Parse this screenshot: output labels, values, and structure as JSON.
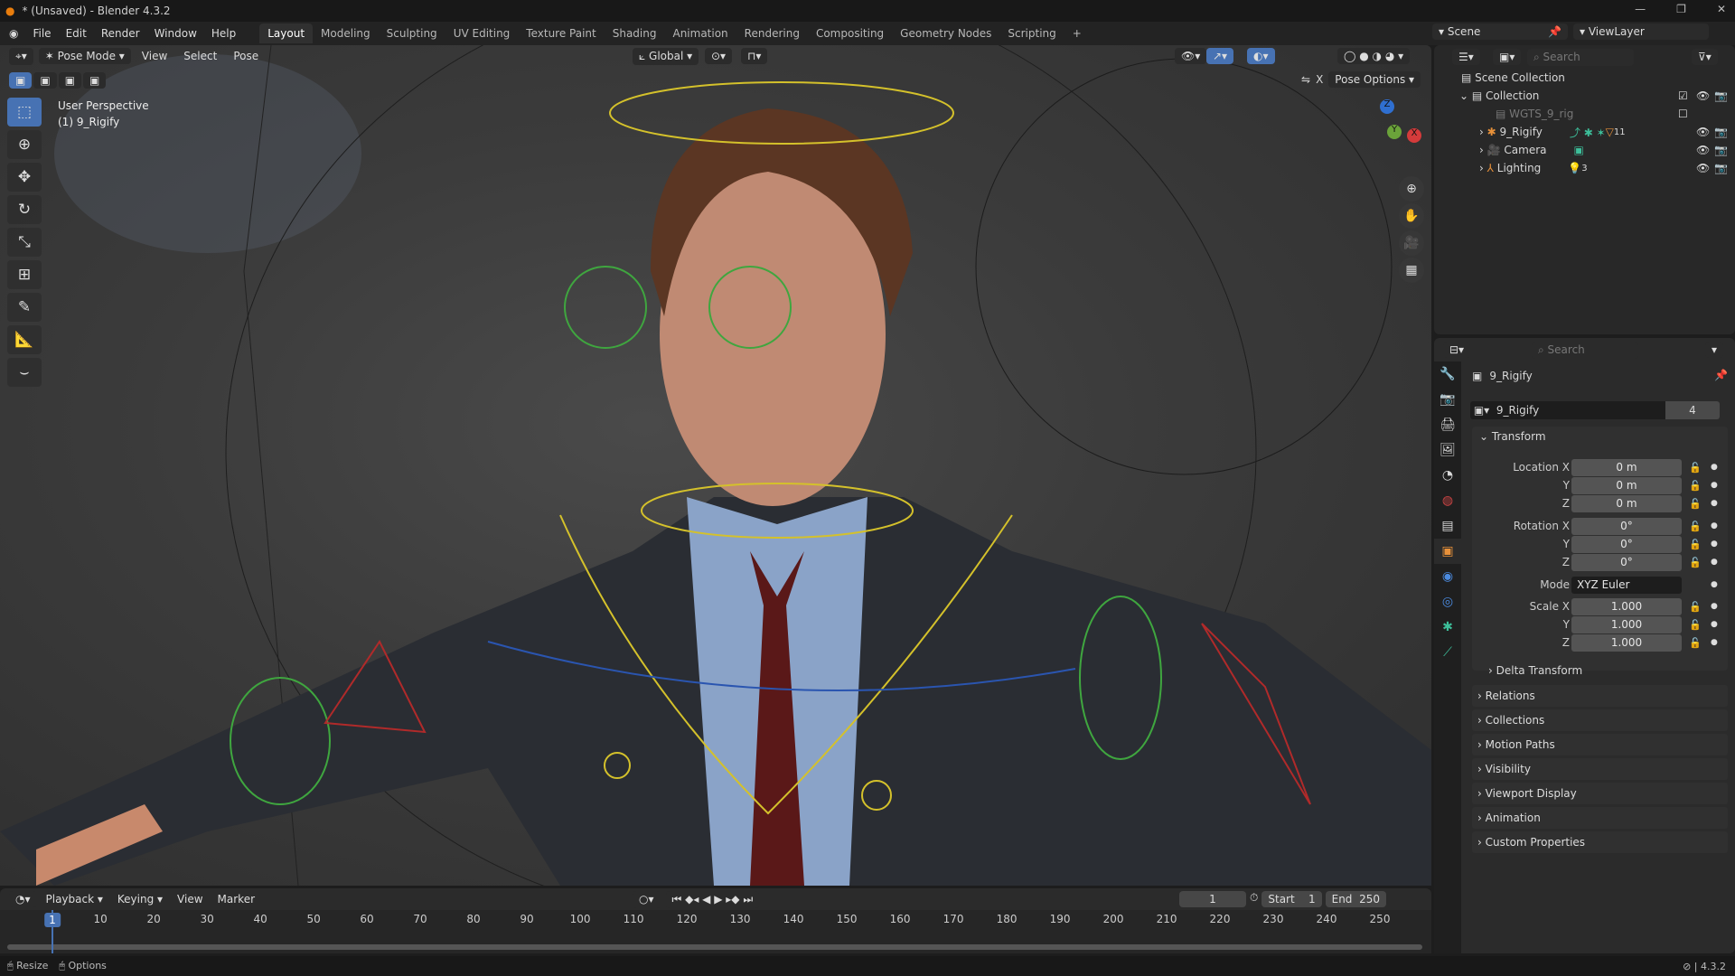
{
  "window": {
    "title": "* (Unsaved) - Blender 4.3.2"
  },
  "menu": [
    "File",
    "Edit",
    "Render",
    "Window",
    "Help"
  ],
  "workspaces": [
    "Layout",
    "Modeling",
    "Sculpting",
    "UV Editing",
    "Texture Paint",
    "Shading",
    "Animation",
    "Rendering",
    "Compositing",
    "Geometry Nodes",
    "Scripting",
    "+"
  ],
  "scene": {
    "scene": "Scene",
    "view_layer": "ViewLayer"
  },
  "viewport": {
    "mode": "Pose Mode",
    "menus": [
      "View",
      "Select",
      "Pose"
    ],
    "orientation": "Global",
    "pose_options": "Pose Options",
    "overlay_title": "User Perspective",
    "overlay_object": "(1) 9_Rigify",
    "axes": [
      "X",
      "Y",
      "Z"
    ]
  },
  "outliner": {
    "search_placeholder": "Search",
    "items": [
      {
        "name": "Scene Collection"
      },
      {
        "name": "Collection"
      },
      {
        "name": "WGTS_9_rig"
      },
      {
        "name": "9_Rigify",
        "badge": "11"
      },
      {
        "name": "Camera"
      },
      {
        "name": "Lighting",
        "badge": "3"
      }
    ]
  },
  "properties": {
    "search_placeholder": "Search",
    "object_name": "9_Rigify",
    "datablock": "9_Rigify",
    "users": "4",
    "transform_label": "Transform",
    "rows": [
      {
        "label": "Location X",
        "value": "0 m"
      },
      {
        "label": "Y",
        "value": "0 m"
      },
      {
        "label": "Z",
        "value": "0 m"
      },
      {
        "label": "Rotation X",
        "value": "0°"
      },
      {
        "label": "Y",
        "value": "0°"
      },
      {
        "label": "Z",
        "value": "0°"
      },
      {
        "label": "Mode",
        "value": "XYZ Euler"
      },
      {
        "label": "Scale X",
        "value": "1.000"
      },
      {
        "label": "Y",
        "value": "1.000"
      },
      {
        "label": "Z",
        "value": "1.000"
      }
    ],
    "delta": "Delta Transform",
    "panels": [
      "Relations",
      "Collections",
      "Motion Paths",
      "Visibility",
      "Viewport Display",
      "Animation",
      "Custom Properties"
    ]
  },
  "timeline": {
    "menus": [
      "Playback",
      "Keying",
      "View",
      "Marker"
    ],
    "current_frame": "1",
    "start_label": "Start",
    "start": "1",
    "end_label": "End",
    "end": "250",
    "ticks": [
      "1",
      "10",
      "20",
      "30",
      "40",
      "50",
      "60",
      "70",
      "80",
      "90",
      "100",
      "110",
      "120",
      "130",
      "140",
      "150",
      "160",
      "170",
      "180",
      "190",
      "200",
      "210",
      "220",
      "230",
      "240",
      "250"
    ]
  },
  "status": {
    "resize": "Resize",
    "options": "Options",
    "version": "4.3.2"
  }
}
